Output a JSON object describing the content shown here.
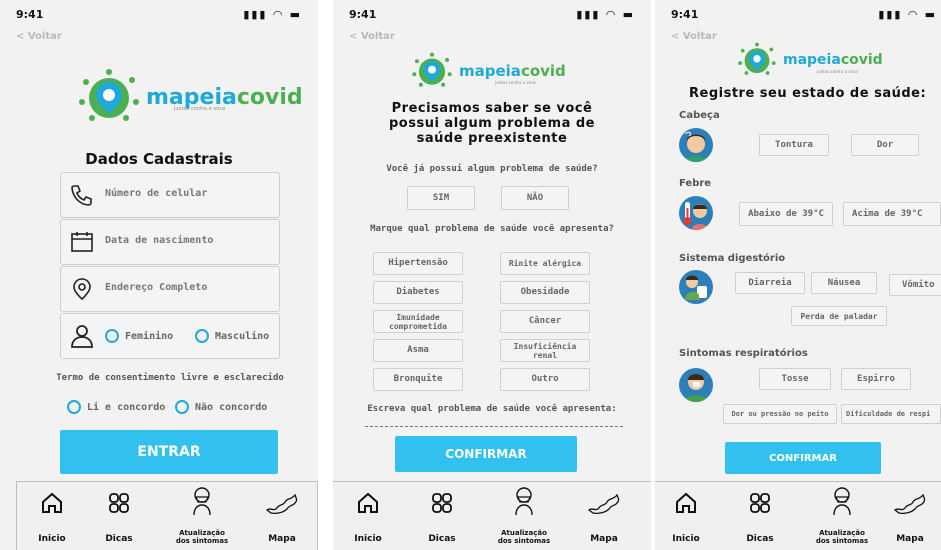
{
  "status_time": "9:41",
  "back_label": "< Voltar",
  "brand": {
    "mapeia": "mapeia",
    "covid": "covid",
    "tagline": "juntos contra o vírus"
  },
  "screen1": {
    "title": "Dados Cadastrais",
    "fields": [
      {
        "label": "Número de celular",
        "icon": "phone-icon"
      },
      {
        "label": "Data de nascimento",
        "icon": "calendar-icon"
      },
      {
        "label": "Endereço Completo",
        "icon": "location-pin-icon"
      }
    ],
    "gender": {
      "female": "Feminino",
      "male": "Masculino"
    },
    "consent_title": "Termo de consentimento livre e esclarecido",
    "consent_yes": "Li e concordo",
    "consent_no": "Não concordo",
    "submit": "ENTRAR"
  },
  "screen2": {
    "title_lines": [
      "Precisamos saber se você",
      "possui algum problema de",
      "saúde preexistente"
    ],
    "question1": "Você já possui algum problema de saúde?",
    "yes": "SIM",
    "no": "NÃO",
    "question2": "Marque qual problema de saúde você apresenta?",
    "conditions": [
      [
        "Hipertensão",
        "Rinite alérgica"
      ],
      [
        "Diabetes",
        "Obesidade"
      ],
      [
        "Imunidade comprometida",
        "Câncer"
      ],
      [
        "Asma",
        "Insuficiência renal"
      ],
      [
        "Bronquite",
        "Outro"
      ]
    ],
    "question3": "Escreva qual problema de saúde você apresenta:",
    "confirm": "CONFIRMAR"
  },
  "screen3": {
    "title": "Registre seu estado de saúde:",
    "categories": [
      {
        "name": "Cabeça",
        "options": [
          "Tontura",
          "Dor"
        ]
      },
      {
        "name": "Febre",
        "options": [
          "Abaixo de 39°C",
          "Acima de 39°C"
        ]
      },
      {
        "name": "Sistema digestório",
        "options": [
          "Diarreia",
          "Náusea",
          "Vômito",
          "Perda de paladar"
        ]
      },
      {
        "name": "Sintomas respiratórios",
        "options": [
          "Tosse",
          "Espirro",
          "Dor ou pressão no peito",
          "Dificuldade de respi"
        ]
      }
    ],
    "confirm": "CONFIRMAR"
  },
  "nav": [
    {
      "label": "Inicio",
      "icon": "home-icon"
    },
    {
      "label": "Dicas",
      "icon": "grid-icon"
    },
    {
      "label": "Atualização dos sintomas",
      "line1": "Atualização",
      "line2": "dos sintomas",
      "icon": "person-mask-icon"
    },
    {
      "label": "Mapa",
      "icon": "map-icon"
    }
  ],
  "colors": {
    "accent": "#32c1ee",
    "brand_blue": "#1fa9d8",
    "brand_green": "#4caf50",
    "background": "#f2f2f2"
  }
}
